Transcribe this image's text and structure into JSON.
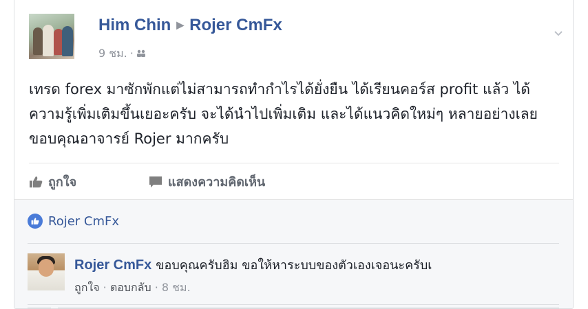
{
  "post": {
    "author": "Him Chin",
    "target": "Rojer CmFx",
    "time": "9 ชม.",
    "audience_icon": "friends-icon",
    "body": "เทรด forex มาซักพักแต่ไม่สามารถทำกำไรได้ยั่งยืน ได้เรียนคอร์ส profit แล้ว ได้ความรู้เพิ่มเติมขึ้นเยอะครับ จะได้นำไปเพิ่มเติม และได้แนวคิดใหม่ๆ หลายอย่างเลย ขอบคุณอาจารย์ Rojer มากครับ"
  },
  "actions": {
    "like_label": "ถูกใจ",
    "comment_label": "แสดงความคิดเห็น"
  },
  "reactions": {
    "liker": "Rojer CmFx"
  },
  "comment": {
    "author": "Rojer CmFx",
    "text": "ขอบคุณครับฮิม ขอให้หาระบบของตัวเองเจอนะครับเ",
    "like_label": "ถูกใจ",
    "reply_label": "ตอบกลับ",
    "time": "8 ชม."
  },
  "colors": {
    "link": "#365899",
    "meta": "#90949c",
    "like_badge": "#4a7bd8"
  }
}
